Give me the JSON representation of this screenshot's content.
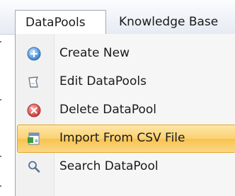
{
  "menubar": {
    "tabs": [
      {
        "label": "DataPools",
        "active": true
      },
      {
        "label": "Knowledge Base",
        "active": false
      }
    ]
  },
  "dropdown": {
    "items": [
      {
        "label": "Create New",
        "icon": "create-new-icon",
        "highlighted": false
      },
      {
        "label": "Edit DataPools",
        "icon": "edit-icon",
        "highlighted": false
      },
      {
        "label": "Delete DataPool",
        "icon": "delete-icon",
        "highlighted": false
      },
      {
        "label": "Import From CSV File",
        "icon": "import-csv-icon",
        "highlighted": true
      },
      {
        "label": "Search DataPool",
        "icon": "search-icon",
        "highlighted": false
      }
    ]
  },
  "colors": {
    "highlight": "#fbd172",
    "delete_icon": "#d64545",
    "create_icon": "#3a8fd8"
  }
}
